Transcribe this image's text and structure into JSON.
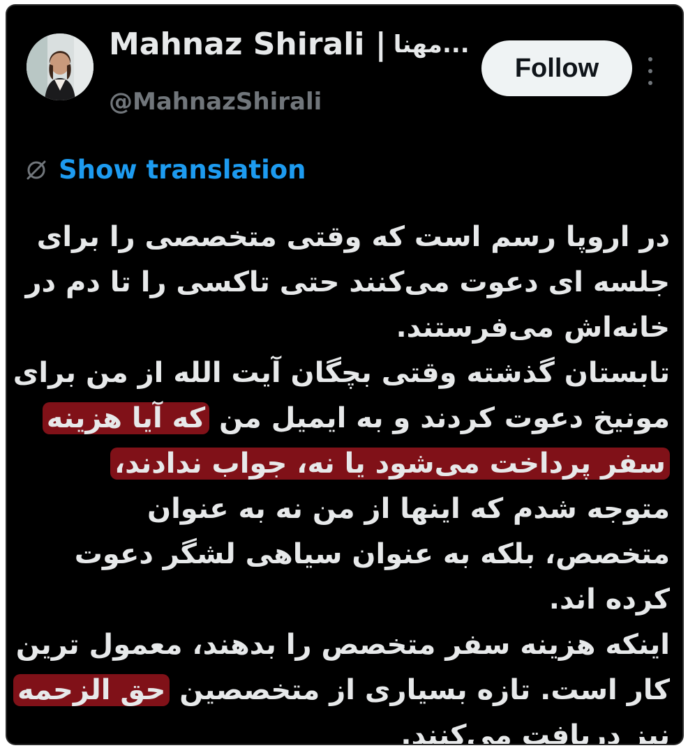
{
  "header": {
    "display_name": "Mahnaz Shirali |",
    "display_name_fa": "مهنا...",
    "handle": "@MahnazShirali",
    "follow_label": "Follow"
  },
  "translate": {
    "label": "Show translation"
  },
  "tweet": {
    "lines": [
      {
        "text": "در اروپا رسم است که وقتی متخصصی را برای"
      },
      {
        "text": "جلسه ای دعوت می‌کنند حتی تاکسی را تا دم در"
      },
      {
        "text": "خانه‌اش می‌فرستند."
      },
      {
        "text": "تابستان گذشته وقتی بچگان آیت الله از من برای"
      },
      {
        "text": "مونیخ دعوت کردند و به ایمیل من ",
        "highlight": "که آیا هزینه"
      },
      {
        "highlight": "سفر پرداخت می‌شود یا نه، جواب ندادند،",
        "text": ""
      },
      {
        "text": "متوجه شدم که اینها از من نه به عنوان"
      },
      {
        "text": "متخصص، بلکه به عنوان سیاهی لشگر دعوت"
      },
      {
        "text": "کرده اند."
      },
      {
        "text": "اینکه هزینه سفر متخصص را بدهند، معمول ترین"
      },
      {
        "text": "کار است. تازه بسیاری از متخصصین ",
        "highlight": "حق الزحمه"
      },
      {
        "text": "نیز دریافت می‌کنند."
      }
    ]
  },
  "colors": {
    "background": "#000000",
    "text": "#e7e9ea",
    "muted": "#71767b",
    "link": "#1d9bf0",
    "highlight": "#96141c",
    "button_bg": "#eff3f4"
  },
  "icons": {
    "translate": "globe-slash-icon",
    "more": "more-vertical-icon"
  }
}
